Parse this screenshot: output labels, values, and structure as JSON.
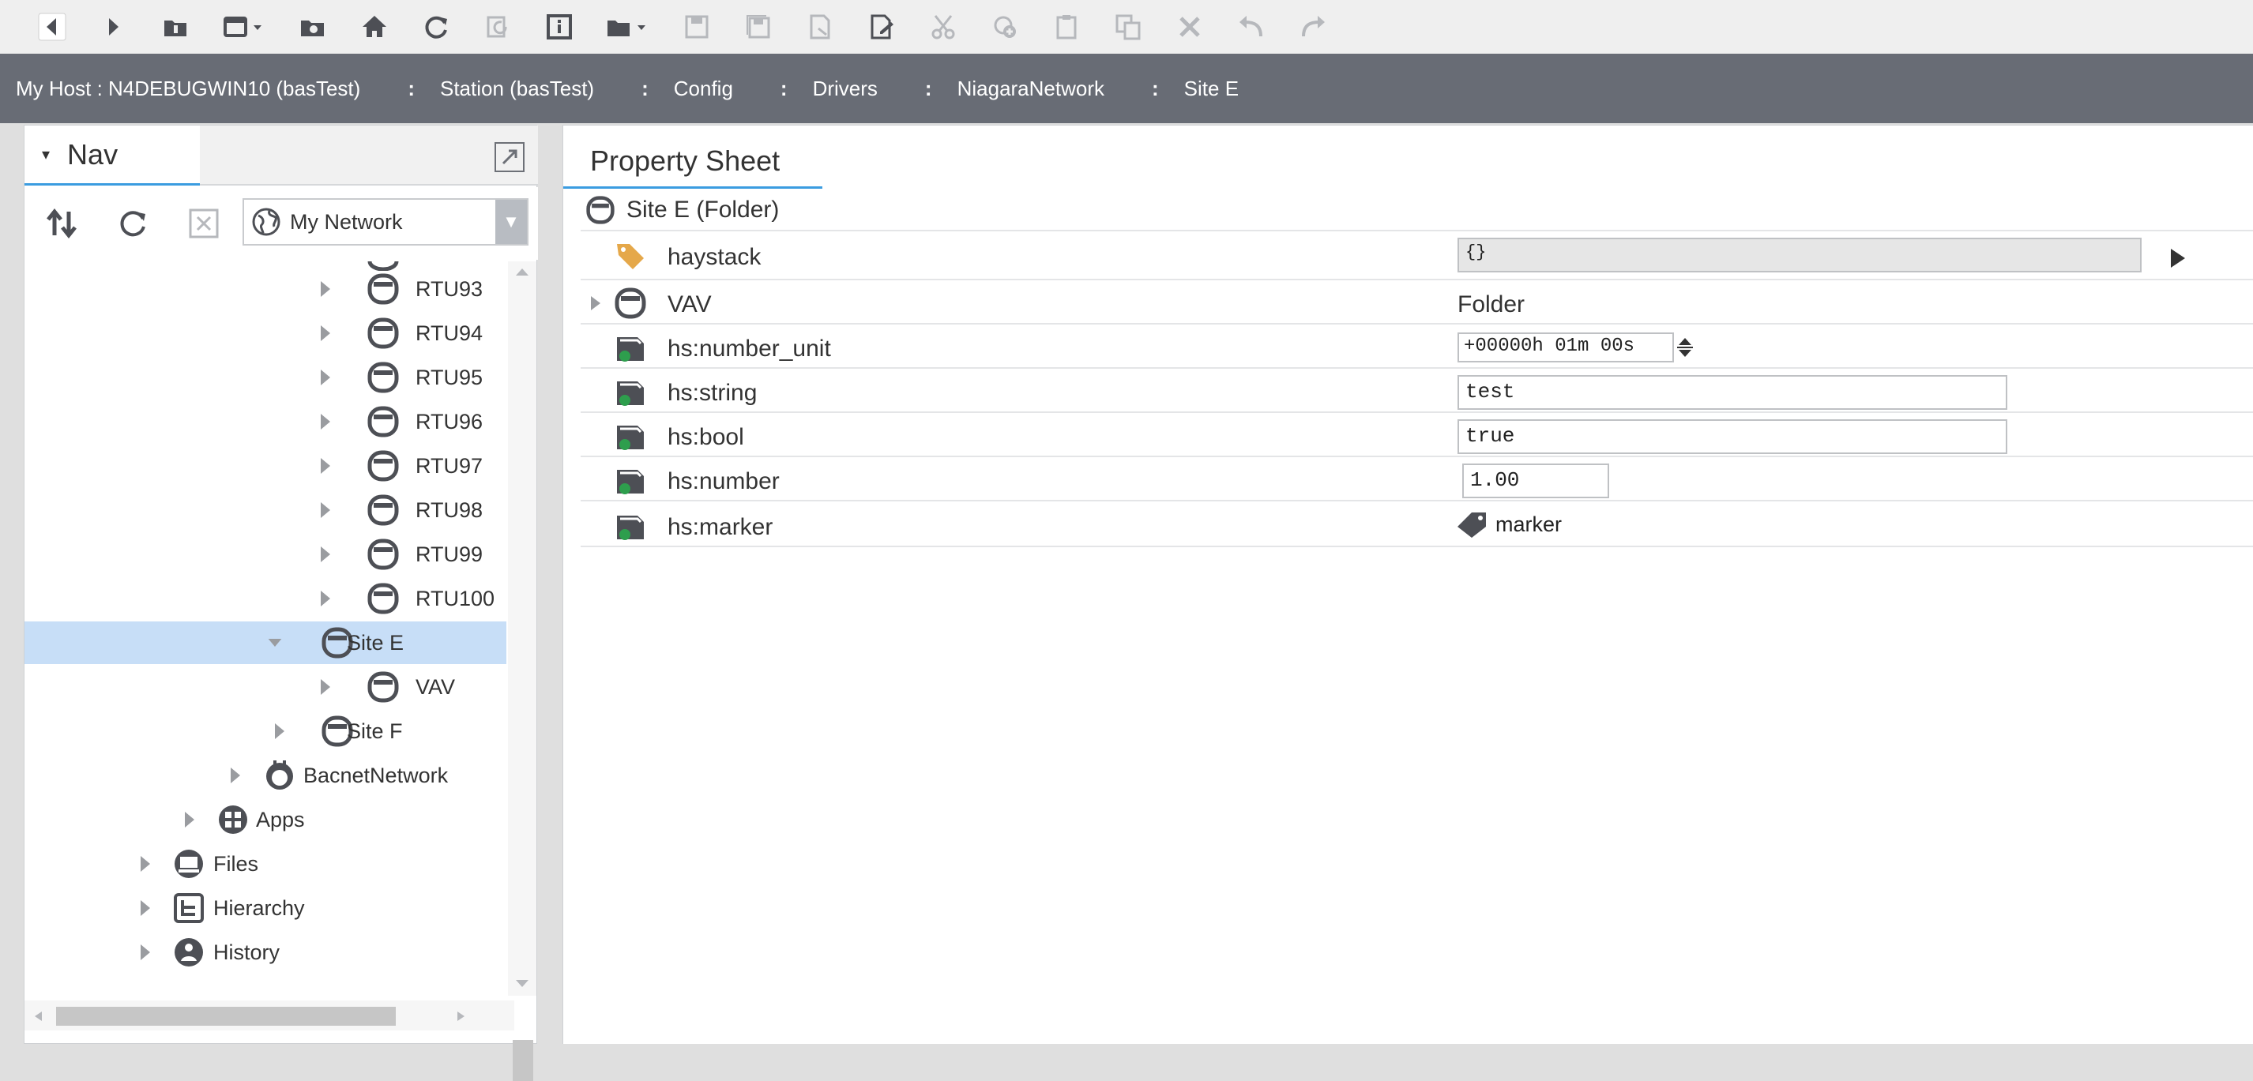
{
  "toolbar": {
    "items": [
      {
        "name": "back-icon"
      },
      {
        "name": "forward-icon"
      },
      {
        "name": "up-level-icon"
      },
      {
        "name": "view-selector-icon"
      },
      {
        "name": "open-folder-icon"
      },
      {
        "name": "home-icon"
      },
      {
        "name": "refresh-icon"
      },
      {
        "name": "refresh-tree-icon"
      },
      {
        "name": "info-icon"
      },
      {
        "name": "open-file-icon"
      },
      {
        "name": "save-icon"
      },
      {
        "name": "save-all-icon"
      },
      {
        "name": "export-icon"
      },
      {
        "name": "edit-document-icon"
      },
      {
        "name": "cut-icon"
      },
      {
        "name": "add-icon"
      },
      {
        "name": "paste-icon"
      },
      {
        "name": "duplicate-icon"
      },
      {
        "name": "delete-icon"
      },
      {
        "name": "undo-icon"
      },
      {
        "name": "redo-icon"
      }
    ]
  },
  "breadcrumb": {
    "items": [
      "My Host : N4DEBUGWIN10 (basTest)",
      "Station (basTest)",
      "Config",
      "Drivers",
      "NiagaraNetwork",
      "Site E"
    ],
    "separator": ":"
  },
  "nav": {
    "tab_label": "Nav",
    "network_select": "My Network",
    "tree": [
      {
        "label": "RTU93"
      },
      {
        "label": "RTU94"
      },
      {
        "label": "RTU95"
      },
      {
        "label": "RTU96"
      },
      {
        "label": "RTU97"
      },
      {
        "label": "RTU98"
      },
      {
        "label": "RTU99"
      },
      {
        "label": "RTU100"
      },
      {
        "label": "Site E"
      },
      {
        "label": "VAV"
      },
      {
        "label": "Site F"
      },
      {
        "label": "BacnetNetwork"
      },
      {
        "label": "Apps"
      },
      {
        "label": "Files"
      },
      {
        "label": "Hierarchy"
      },
      {
        "label": "History"
      }
    ]
  },
  "property_sheet": {
    "tab_label": "Property Sheet",
    "title": "Site E  (Folder)",
    "rows": {
      "haystack": {
        "name": "haystack",
        "value": "{}"
      },
      "vav": {
        "name": "VAV",
        "value": "Folder"
      },
      "number_unit": {
        "name": "hs:number_unit",
        "value": "+00000h 01m 00s"
      },
      "string": {
        "name": "hs:string",
        "value": "test"
      },
      "bool": {
        "name": "hs:bool",
        "value": "true"
      },
      "number": {
        "name": "hs:number",
        "value": "1.00"
      },
      "marker": {
        "name": "hs:marker",
        "value": "marker"
      }
    }
  },
  "colors": {
    "accent": "#3b9ce0",
    "selection": "#c7def7",
    "breadcrumb_bg": "#686c75",
    "icon": "#4d4f55",
    "tag": "#e5a84a"
  }
}
